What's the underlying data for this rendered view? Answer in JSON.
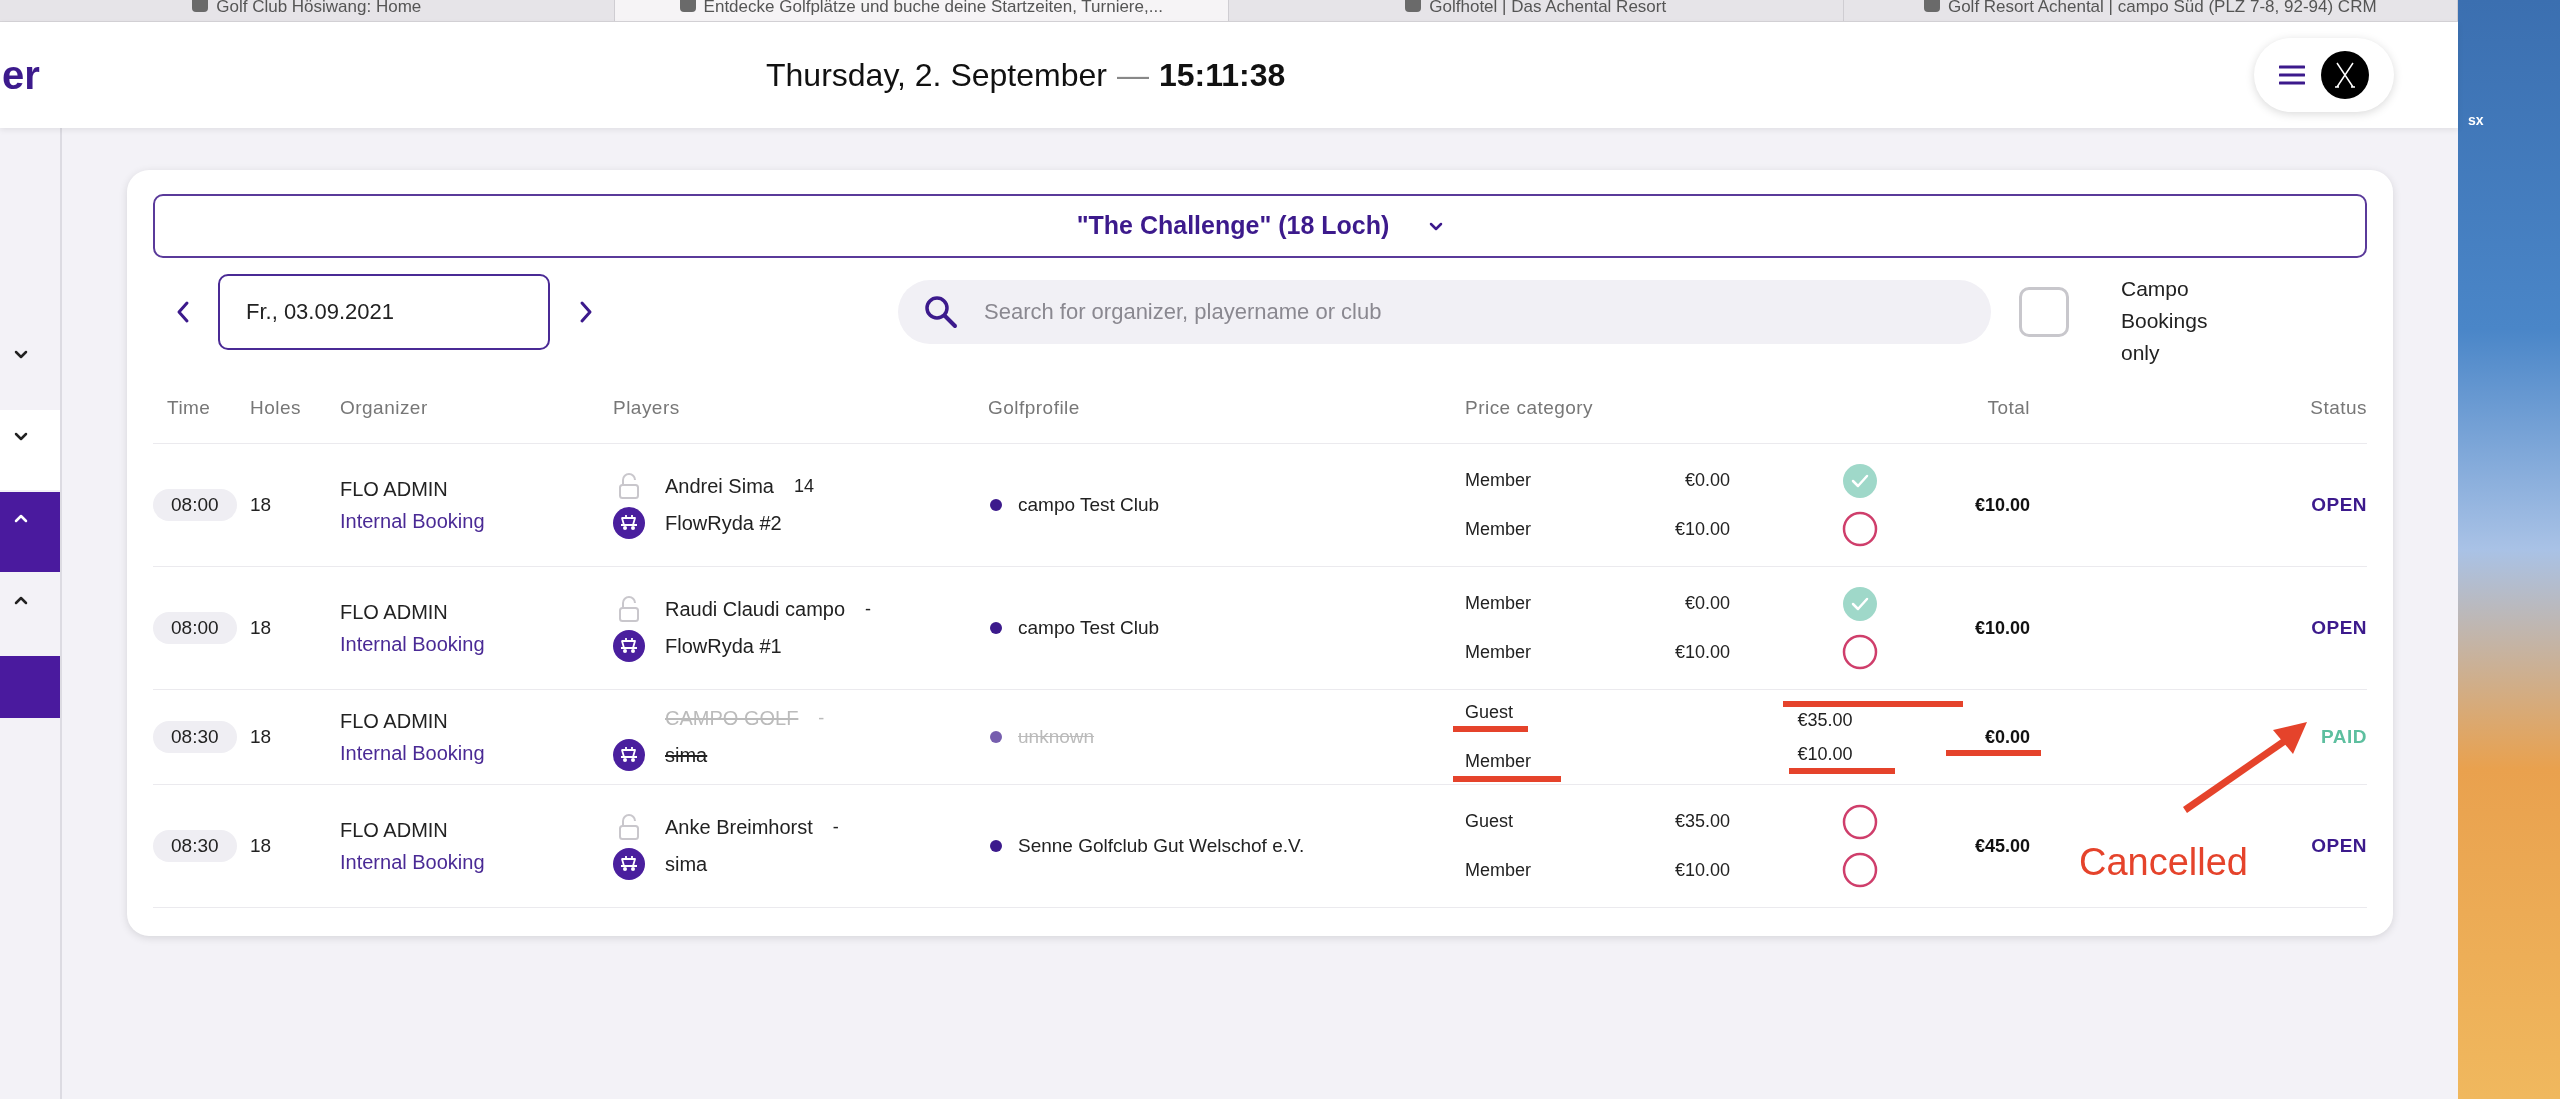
{
  "browser_tabs": [
    {
      "title": "Golf Club Hösiwang: Home",
      "selected": false
    },
    {
      "title": "Entdecke Golfplätze und buche deine Startzeiten, Turniere,...",
      "selected": true
    },
    {
      "title": "Golfhotel | Das Achental Resort",
      "selected": false
    },
    {
      "title": "Golf Resort Achental | campo Süd (PLZ 7-8, 92-94) CRM",
      "selected": false
    }
  ],
  "header": {
    "logo_text": "er",
    "date": "Thursday, 2. September",
    "separator": "—",
    "time": "15:11:38"
  },
  "sidebar": {
    "items": [
      {
        "expanded": false,
        "selected": false
      },
      {
        "expanded": false,
        "selected": false
      },
      {
        "expanded": true,
        "selected": true
      },
      {
        "expanded": true,
        "selected": false
      }
    ]
  },
  "course_select": {
    "value": "\"The Challenge\" (18 Loch)"
  },
  "date_field": {
    "value": "Fr., 03.09.2021"
  },
  "search": {
    "placeholder": "Search for organizer, playername or club"
  },
  "campo_filter": {
    "label": "Campo Bookings only",
    "checked": false
  },
  "table": {
    "columns": [
      "Time",
      "Holes",
      "Organizer",
      "Players",
      "Golfprofile",
      "Price category",
      "Total",
      "Status"
    ],
    "rows": [
      {
        "time": "08:00",
        "holes": "18",
        "organizer": "FLO ADMIN",
        "booking_type": "Internal Booking",
        "cancelled": false,
        "players": [
          {
            "kind": "lock",
            "name": "Andrei Sima",
            "suffix": "14"
          },
          {
            "kind": "cart",
            "name": "FlowRyda #2"
          }
        ],
        "golfprofile": "campo Test Club",
        "prices": [
          {
            "category": "Member",
            "price": "€0.00",
            "paid": true
          },
          {
            "category": "Member",
            "price": "€10.00",
            "paid": false
          }
        ],
        "total": "€10.00",
        "status": {
          "kind": "open",
          "text": "OPEN"
        }
      },
      {
        "time": "08:00",
        "holes": "18",
        "organizer": "FLO ADMIN",
        "booking_type": "Internal Booking",
        "cancelled": false,
        "players": [
          {
            "kind": "lock",
            "name": "Raudi Claudi campo",
            "suffix": "-"
          },
          {
            "kind": "cart",
            "name": "FlowRyda #1"
          }
        ],
        "golfprofile": "campo Test Club",
        "prices": [
          {
            "category": "Member",
            "price": "€0.00",
            "paid": true
          },
          {
            "category": "Member",
            "price": "€10.00",
            "paid": false
          }
        ],
        "total": "€10.00",
        "status": {
          "kind": "open",
          "text": "OPEN"
        }
      },
      {
        "time": "08:30",
        "holes": "18",
        "organizer": "FLO ADMIN",
        "booking_type": "Internal Booking",
        "cancelled": true,
        "players": [
          {
            "kind": "none",
            "name": "CAMPO GOLF",
            "suffix": "-"
          },
          {
            "kind": "cart",
            "name": "sima"
          }
        ],
        "golfprofile": "unknown",
        "prices": [
          {
            "category": "Guest",
            "price": "€35.00"
          },
          {
            "category": "Member",
            "price": "€10.00"
          }
        ],
        "total": "€0.00",
        "status": {
          "kind": "paid",
          "text": "PAID"
        }
      },
      {
        "time": "08:30",
        "holes": "18",
        "organizer": "FLO ADMIN",
        "booking_type": "Internal Booking",
        "cancelled": false,
        "players": [
          {
            "kind": "lock",
            "name": "Anke Breimhorst",
            "suffix": "-"
          },
          {
            "kind": "cart",
            "name": "sima"
          }
        ],
        "golfprofile": "Senne Golfclub Gut Welschof e.V.",
        "prices": [
          {
            "category": "Guest",
            "price": "€35.00",
            "paid": false
          },
          {
            "category": "Member",
            "price": "€10.00",
            "paid": false
          }
        ],
        "total": "€45.00",
        "status": {
          "kind": "open",
          "text": "OPEN"
        }
      }
    ]
  },
  "annotation": {
    "text": "Cancelled"
  },
  "desktop": {
    "label": "sx"
  }
}
